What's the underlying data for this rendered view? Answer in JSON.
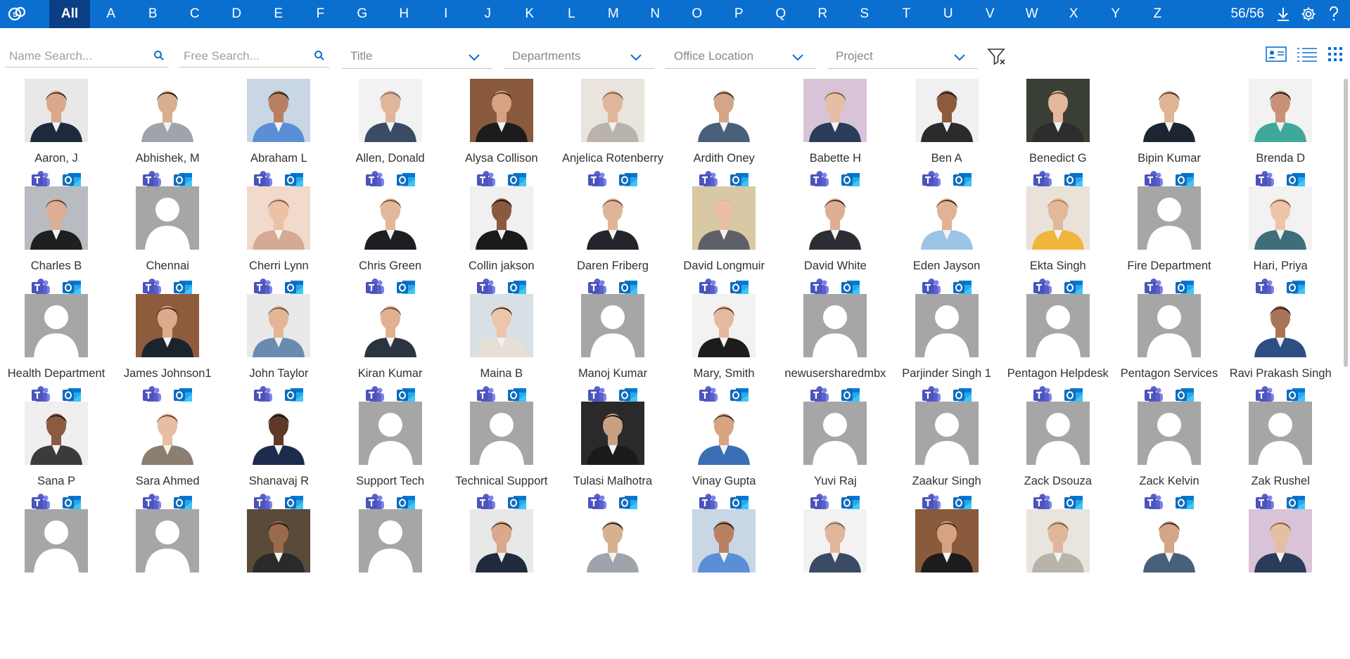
{
  "alphabet": {
    "items": [
      "All",
      "A",
      "B",
      "C",
      "D",
      "E",
      "F",
      "G",
      "H",
      "I",
      "J",
      "K",
      "L",
      "M",
      "N",
      "O",
      "P",
      "Q",
      "R",
      "S",
      "T",
      "U",
      "V",
      "W",
      "X",
      "Y",
      "Z"
    ],
    "selected": "All"
  },
  "header": {
    "count": "56/56"
  },
  "filters": {
    "name_search_placeholder": "Name Search...",
    "free_search_placeholder": "Free Search...",
    "title": "Title",
    "departments": "Departments",
    "office_location": "Office Location",
    "project": "Project"
  },
  "people": [
    {
      "name": "Aaron, J",
      "photo": "photo",
      "skin": "#d9a98a",
      "hair": "#3a2a20",
      "shirt": "#1f2a3d",
      "bg": "#e8e8e8"
    },
    {
      "name": "Abhishek, M",
      "photo": "photo",
      "skin": "#d7b08f",
      "hair": "#1b1b1b",
      "shirt": "#9ea4ab",
      "bg": "#ffffff"
    },
    {
      "name": "Abraham L",
      "photo": "photo",
      "skin": "#b88063",
      "hair": "#1e1a16",
      "shirt": "#5a8fd8",
      "bg": "#c9d6e4"
    },
    {
      "name": "Allen, Donald",
      "photo": "photo",
      "skin": "#e1b59a",
      "hair": "#6b6b6b",
      "shirt": "#3a4b63",
      "bg": "#f2f2f2"
    },
    {
      "name": "Alysa Collison",
      "photo": "photo",
      "skin": "#d7a282",
      "hair": "#3c2a1d",
      "shirt": "#1c1c1c",
      "bg": "#8a5a3c"
    },
    {
      "name": "Anjelica Rotenberry",
      "photo": "photo",
      "skin": "#e0b69b",
      "hair": "#7a5b3c",
      "shirt": "#b9b3ab",
      "bg": "#e9e4de"
    },
    {
      "name": "Ardith Oney",
      "photo": "photo",
      "skin": "#d4a586",
      "hair": "#3b2b1f",
      "shirt": "#49607a",
      "bg": "#ffffff"
    },
    {
      "name": "Babette H",
      "photo": "photo",
      "skin": "#e4bfa4",
      "hair": "#7a5a3d",
      "shirt": "#2b3b5a",
      "bg": "#d9c3d8"
    },
    {
      "name": "Ben A",
      "photo": "photo",
      "skin": "#8e5a3d",
      "hair": "#151515",
      "shirt": "#2b2b2b",
      "bg": "#f0f0f0"
    },
    {
      "name": "Benedict G",
      "photo": "photo",
      "skin": "#e2b79b",
      "hair": "#5a3b22",
      "shirt": "#2d2d2d",
      "bg": "#3a3f35"
    },
    {
      "name": "Bipin Kumar",
      "photo": "photo",
      "skin": "#e0b394",
      "hair": "#4a3220",
      "shirt": "#1e2430",
      "bg": "#ffffff"
    },
    {
      "name": "Brenda D",
      "photo": "photo",
      "skin": "#c99277",
      "hair": "#1a1411",
      "shirt": "#3fa89a",
      "bg": "#f2f2f2"
    },
    {
      "name": "Charles B",
      "photo": "photo",
      "skin": "#dcae92",
      "hair": "#5b4030",
      "shirt": "#1f1f1f",
      "bg": "#b8bcc0"
    },
    {
      "name": "Chennai",
      "photo": "placeholder"
    },
    {
      "name": "Cherri Lynn",
      "photo": "photo",
      "skin": "#ecc2a6",
      "hair": "#8e5534",
      "shirt": "#d6a993",
      "bg": "#f1d9cb"
    },
    {
      "name": "Chris Green",
      "photo": "photo",
      "skin": "#e2b89c",
      "hair": "#6b4f35",
      "shirt": "#1d1d22",
      "bg": "#ffffff"
    },
    {
      "name": "Collin jakson",
      "photo": "photo",
      "skin": "#8a5a3f",
      "hair": "#171310",
      "shirt": "#1a1a1a",
      "bg": "#f0f0f0"
    },
    {
      "name": "Daren Friberg",
      "photo": "photo",
      "skin": "#e0b597",
      "hair": "#6a4d33",
      "shirt": "#23252b",
      "bg": "#ffffff"
    },
    {
      "name": "David Longmuir",
      "photo": "photo",
      "skin": "#eac0a4",
      "hair": "#c8c0b4",
      "shirt": "#5d6066",
      "bg": "#d8c9a4"
    },
    {
      "name": "David White",
      "photo": "photo",
      "skin": "#ddb094",
      "hair": "#3a2b20",
      "shirt": "#2c2e33",
      "bg": "#ffffff"
    },
    {
      "name": "Eden Jayson",
      "photo": "photo",
      "skin": "#e0b394",
      "hair": "#3b2b1f",
      "shirt": "#9cc4e6",
      "bg": "#ffffff"
    },
    {
      "name": "Ekta Singh",
      "photo": "photo",
      "skin": "#e2b79a",
      "hair": "#b8864a",
      "shirt": "#f0b63b",
      "bg": "#e8e2d8"
    },
    {
      "name": "Fire Department",
      "photo": "placeholder"
    },
    {
      "name": "Hari, Priya",
      "photo": "photo",
      "skin": "#edc4a8",
      "hair": "#8f4e2e",
      "shirt": "#3e6e7a",
      "bg": "#f2f2f2"
    },
    {
      "name": "Health Department",
      "photo": "placeholder"
    },
    {
      "name": "James Johnson1",
      "photo": "photo",
      "skin": "#ddaa8c",
      "hair": "#3c2b1f",
      "shirt": "#1b2331",
      "bg": "#8e5b3c"
    },
    {
      "name": "John Taylor",
      "photo": "photo",
      "skin": "#e2b597",
      "hair": "#6b5642",
      "shirt": "#6a8bb0",
      "bg": "#e9e9e9"
    },
    {
      "name": "Kiran Kumar",
      "photo": "photo",
      "skin": "#e0b092",
      "hair": "#6a4b32",
      "shirt": "#2c3440",
      "bg": "#ffffff"
    },
    {
      "name": "Maina B",
      "photo": "photo",
      "skin": "#ecc5aa",
      "hair": "#3c2a1e",
      "shirt": "#e6dfd6",
      "bg": "#d7e1e5"
    },
    {
      "name": "Manoj Kumar",
      "photo": "placeholder"
    },
    {
      "name": "Mary, Smith",
      "photo": "photo",
      "skin": "#e5b99d",
      "hair": "#5a3a26",
      "shirt": "#1c1c1c",
      "bg": "#f2f2f2"
    },
    {
      "name": "newusersharedmbx",
      "photo": "placeholder"
    },
    {
      "name": "Parjinder Singh 1",
      "photo": "placeholder"
    },
    {
      "name": "Pentagon Helpdesk",
      "photo": "placeholder"
    },
    {
      "name": "Pentagon Services",
      "photo": "placeholder"
    },
    {
      "name": "Ravi Prakash Singh",
      "photo": "photo",
      "skin": "#a97456",
      "hair": "#1b1612",
      "shirt": "#2d4e82",
      "bg": "#ffffff"
    },
    {
      "name": "Sana P",
      "photo": "photo",
      "skin": "#8a5a41",
      "hair": "#241a14",
      "shirt": "#3b3b3b",
      "bg": "#efefef"
    },
    {
      "name": "Sara Ahmed",
      "photo": "photo",
      "skin": "#e6bea2",
      "hair": "#6b4226",
      "shirt": "#8d7e72",
      "bg": "#ffffff"
    },
    {
      "name": "Shanavaj R",
      "photo": "photo",
      "skin": "#5e3a26",
      "hair": "#141010",
      "shirt": "#1d2b4d",
      "bg": "#ffffff"
    },
    {
      "name": "Support Tech",
      "photo": "placeholder"
    },
    {
      "name": "Technical Support",
      "photo": "placeholder"
    },
    {
      "name": "Tulasi Malhotra",
      "photo": "photo",
      "skin": "#caa083",
      "hair": "#151110",
      "shirt": "#1b1b1b",
      "bg": "#2a2a2a"
    },
    {
      "name": "Vinay Gupta",
      "photo": "photo",
      "skin": "#d7a380",
      "hair": "#3a2b20",
      "shirt": "#3b6fb3",
      "bg": "#ffffff"
    },
    {
      "name": "Yuvi Raj",
      "photo": "placeholder"
    },
    {
      "name": "Zaakur Singh",
      "photo": "placeholder"
    },
    {
      "name": "Zack Dsouza",
      "photo": "placeholder"
    },
    {
      "name": "Zack Kelvin",
      "photo": "placeholder"
    },
    {
      "name": "Zak Rushel",
      "photo": "placeholder"
    },
    {
      "name": "",
      "photo": "placeholder"
    },
    {
      "name": "",
      "photo": "placeholder"
    },
    {
      "name": "",
      "photo": "photo",
      "skin": "#9a6a4c",
      "hair": "#1b1511",
      "shirt": "#2a2a2a",
      "bg": "#5a4a3a"
    },
    {
      "name": "",
      "photo": "placeholder"
    },
    {
      "name": "",
      "photo": "photo",
      "skin": "#d9a98a",
      "hair": "#3a2a20",
      "shirt": "#1f2a3d",
      "bg": "#e8e8e8"
    },
    {
      "name": "",
      "photo": "photo",
      "skin": "#d7b08f",
      "hair": "#1b1b1b",
      "shirt": "#9ea4ab",
      "bg": "#ffffff"
    },
    {
      "name": "",
      "photo": "photo",
      "skin": "#b88063",
      "hair": "#1e1a16",
      "shirt": "#5a8fd8",
      "bg": "#c9d6e4"
    },
    {
      "name": "",
      "photo": "photo",
      "skin": "#e1b59a",
      "hair": "#6b6b6b",
      "shirt": "#3a4b63",
      "bg": "#f2f2f2"
    },
    {
      "name": "",
      "photo": "photo",
      "skin": "#d7a282",
      "hair": "#3c2a1d",
      "shirt": "#1c1c1c",
      "bg": "#8a5a3c"
    },
    {
      "name": "",
      "photo": "photo",
      "skin": "#e0b69b",
      "hair": "#7a5b3c",
      "shirt": "#b9b3ab",
      "bg": "#e9e4de"
    },
    {
      "name": "",
      "photo": "photo",
      "skin": "#d4a586",
      "hair": "#3b2b1f",
      "shirt": "#49607a",
      "bg": "#ffffff"
    },
    {
      "name": "",
      "photo": "photo",
      "skin": "#e4bfa4",
      "hair": "#7a5a3d",
      "shirt": "#2b3b5a",
      "bg": "#d9c3d8"
    }
  ],
  "colors": {
    "brand": "#0b6fd0",
    "selected_letter_bg": "#0a3f86",
    "placeholder": "#a6a6a6",
    "teams": "#5b5fc7",
    "outlook": "#0f6cbd"
  }
}
